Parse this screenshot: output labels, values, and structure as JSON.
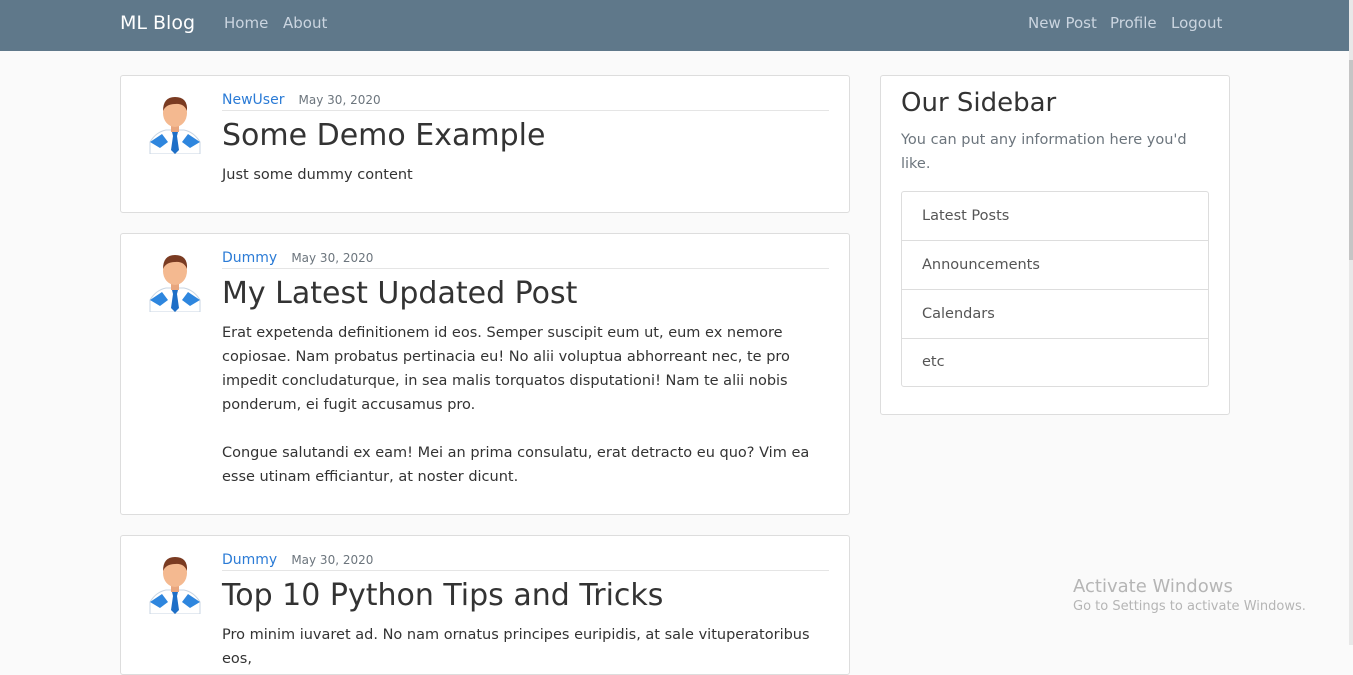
{
  "navbar": {
    "brand": "ML Blog",
    "left_links": [
      "Home",
      "About"
    ],
    "right_links": [
      "New Post",
      "Profile",
      "Logout"
    ]
  },
  "posts": [
    {
      "author": "NewUser",
      "date": "May 30, 2020",
      "title": "Some Demo Example",
      "paragraphs": [
        "Just some dummy content"
      ]
    },
    {
      "author": "Dummy",
      "date": "May 30, 2020",
      "title": "My Latest Updated Post",
      "paragraphs": [
        "Erat expetenda definitionem id eos. Semper suscipit eum ut, eum ex nemore copiosae. Nam probatus pertinacia eu! No alii voluptua abhorreant nec, te pro impedit concludaturque, in sea malis torquatos disputationi! Nam te alii nobis ponderum, ei fugit accusamus pro.",
        "Congue salutandi ex eam! Mei an prima consulatu, erat detracto eu quo? Vim ea esse utinam efficiantur, at noster dicunt."
      ]
    },
    {
      "author": "Dummy",
      "date": "May 30, 2020",
      "title": "Top 10 Python Tips and Tricks",
      "paragraphs": [
        "Pro minim iuvaret ad. No nam ornatus principes euripidis, at sale vituperatoribus eos,"
      ]
    }
  ],
  "sidebar": {
    "title": "Our Sidebar",
    "intro": "You can put any information here you'd like.",
    "items": [
      "Latest Posts",
      "Announcements",
      "Calendars",
      "etc"
    ]
  },
  "watermark": {
    "line1": "Activate Windows",
    "line2": "Go to Settings to activate Windows."
  },
  "colors": {
    "navbar": "#5f788a",
    "link": "#2b7bd6",
    "background": "#fafafa"
  }
}
